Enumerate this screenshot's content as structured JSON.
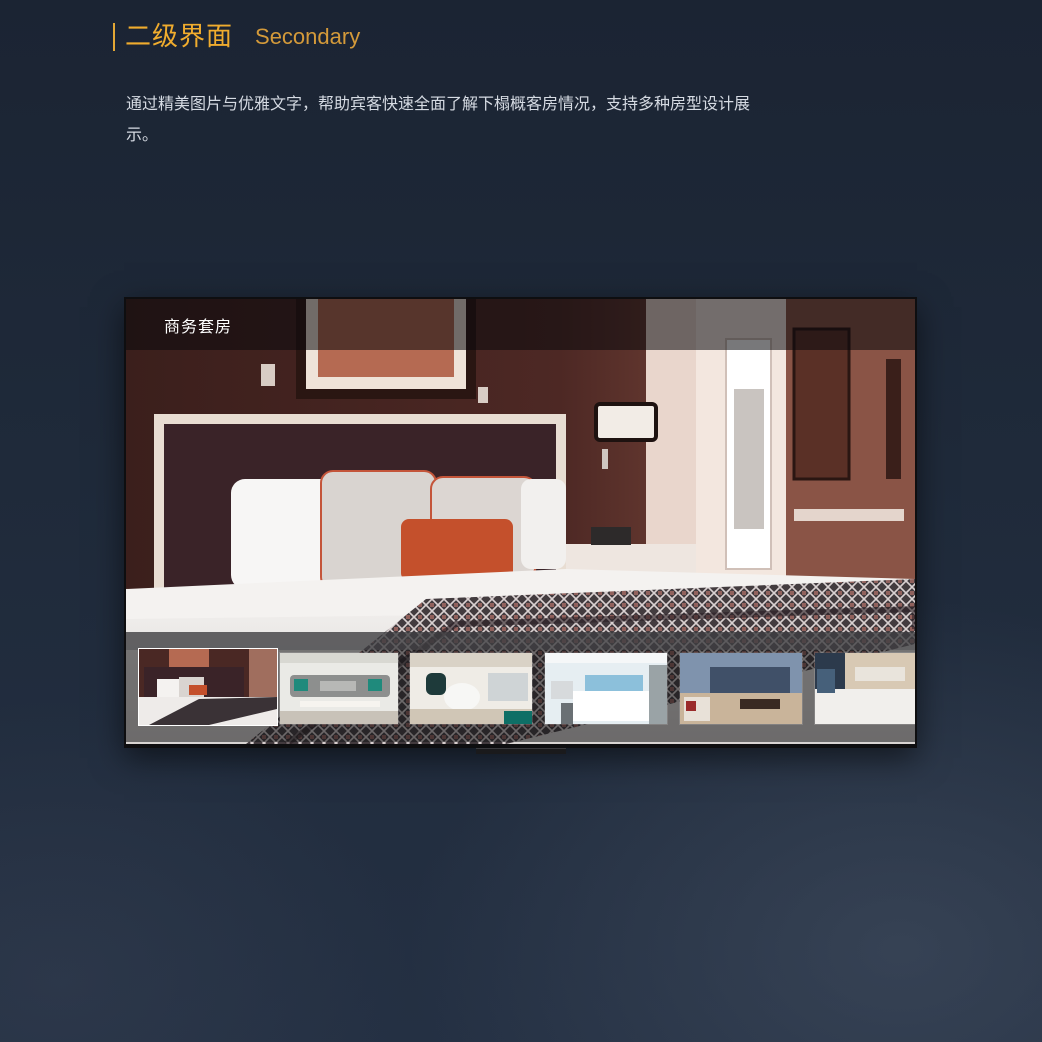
{
  "heading": {
    "title": "二级界面",
    "subtitle": "Secondary",
    "accent_color": "#f0ac2e"
  },
  "description": "通过精美图片与优雅文字，帮助宾客快速全面了解下榻概客房情况，支持多种房型设计展示。",
  "tv": {
    "room_title": "商务套房",
    "selected_thumbnail": 0,
    "thumbnails": [
      {
        "name": "商务套房 bedroom"
      },
      {
        "name": "living room sofa"
      },
      {
        "name": "lounge chairs"
      },
      {
        "name": "twin bed room"
      },
      {
        "name": "city view suite"
      },
      {
        "name": "standard room"
      }
    ]
  }
}
